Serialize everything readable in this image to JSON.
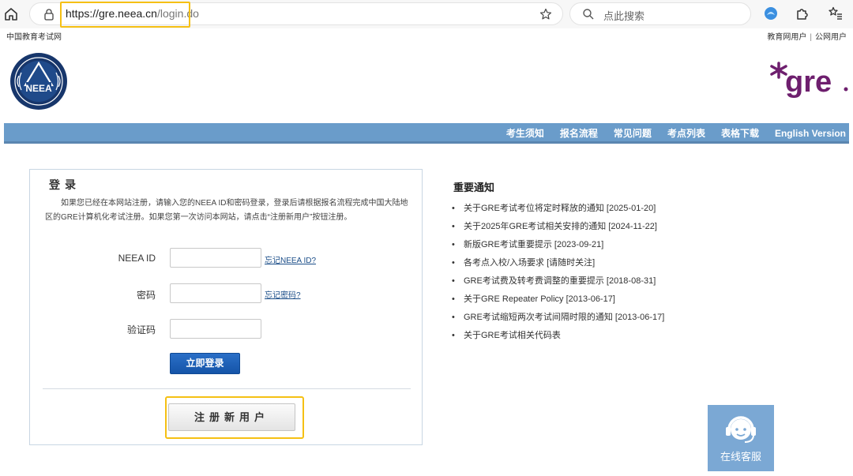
{
  "browser": {
    "url_host": "https://gre.neea.cn",
    "url_path": "/login.do",
    "search_placeholder": "点此搜索"
  },
  "top_strip": {
    "site_name": "中国教育考试网",
    "link_edu_user": "教育网用户",
    "separator": "|",
    "link_public_user": "公网用户"
  },
  "header": {
    "neea_logo_text": "NEEA",
    "gre_logo_text": "gre"
  },
  "nav": {
    "items": [
      "考生须知",
      "报名流程",
      "常见问题",
      "考点列表",
      "表格下载",
      "English Version"
    ]
  },
  "login": {
    "title": "登录",
    "intro": "如果您已经在本网站注册，请输入您的NEEA ID和密码登录，登录后请根据报名流程完成中国大陆地区的GRE计算机化考试注册。如果您第一次访问本网站，请点击“注册新用户”按钮注册。",
    "neea_id_label": "NEEA ID",
    "forgot_id_link": "忘记NEEA ID?",
    "password_label": "密码",
    "forgot_password_link": "忘记密码?",
    "captcha_label": "验证码",
    "login_button": "立即登录",
    "register_button": "注册新用户"
  },
  "notices": {
    "title": "重要通知",
    "items": [
      "关于GRE考试考位将定时释放的通知 [2025-01-20]",
      "关于2025年GRE考试相关安排的通知 [2024-11-22]",
      "新版GRE考试重要提示 [2023-09-21]",
      "各考点入校/入场要求 [请随时关注]",
      "GRE考试费及转考费调整的重要提示 [2018-08-31]",
      "关于GRE Repeater Policy [2013-06-17]",
      "GRE考试缩短两次考试间隔时限的通知 [2013-06-17]",
      "关于GRE考试相关代码表"
    ]
  },
  "customer_service": {
    "label": "在线客服"
  },
  "colors": {
    "nav_blue": "#6a9cca",
    "login_button_blue": "#1f62b8",
    "highlight_yellow": "#f5c014",
    "gre_purple": "#6e1f6e",
    "service_blue": "#7ba8d4"
  }
}
